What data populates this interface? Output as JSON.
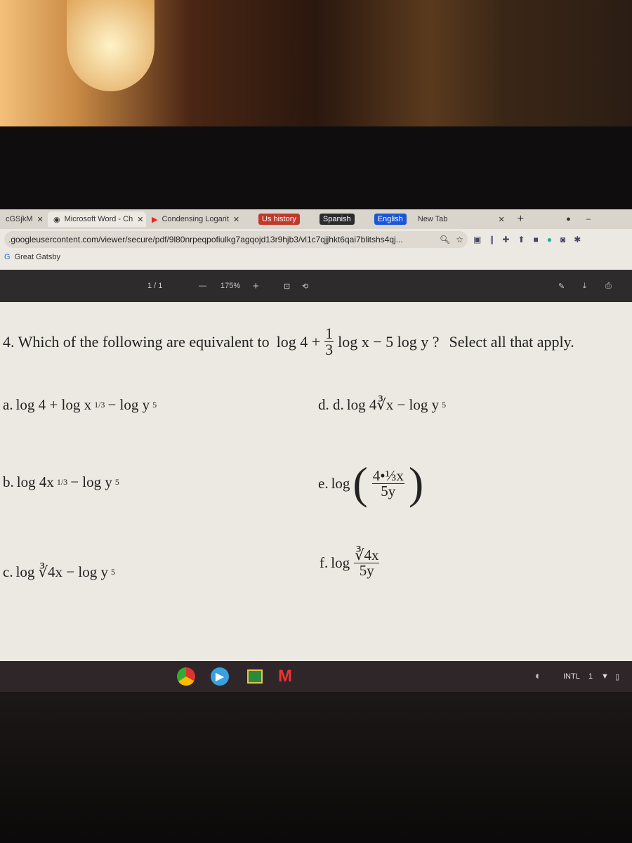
{
  "browser": {
    "tabs": [
      {
        "label": "cGSjkM"
      },
      {
        "label": "Microsoft Word - Ch"
      },
      {
        "label": "Condensing Logarit"
      }
    ],
    "bookmark_chips": [
      {
        "label": "Us history",
        "color": "#c0392b"
      },
      {
        "label": "Spanish",
        "color": "#2b2b2b"
      },
      {
        "label": "English",
        "color": "#1a56d6"
      }
    ],
    "new_tab": "New Tab",
    "url": ".googleusercontent.com/viewer/secure/pdf/9l80nrpeqpofiulkg7agqojd13r9hjb3/vl1c7qjjhkt6qai7blitshs4qj...",
    "bookmark": "Great Gatsby"
  },
  "pdf": {
    "page": "1 / 1",
    "zoom": "175%"
  },
  "question": {
    "prefix": "4. Which of the following are equivalent to",
    "expr_a": "log 4 +",
    "frac_n": "1",
    "frac_d": "3",
    "expr_b": "log x − 5 log y ?",
    "suffix": "Select all that apply."
  },
  "options": {
    "a": {
      "label": "a.",
      "text1": "log 4 + log x",
      "sup1": "1/3",
      "text2": " − log y",
      "sup2": "5"
    },
    "b": {
      "label": "b.",
      "text1": "log 4x",
      "sup1": "1/3",
      "text2": " − log y",
      "sup2": "5"
    },
    "c": {
      "label": "c.",
      "text1": "log ∛4x − log y",
      "sup2": "5"
    },
    "d": {
      "label": "d. d.",
      "text1": "log 4∛x − log y",
      "sup2": "5"
    },
    "e": {
      "label": "e.",
      "log": "log",
      "num": "4•⅓x",
      "den": "5y"
    },
    "f": {
      "label": "f.",
      "log": "log",
      "num": "∛4x",
      "den": "5y"
    }
  },
  "shelf": {
    "status": "INTL",
    "notif": "1"
  }
}
